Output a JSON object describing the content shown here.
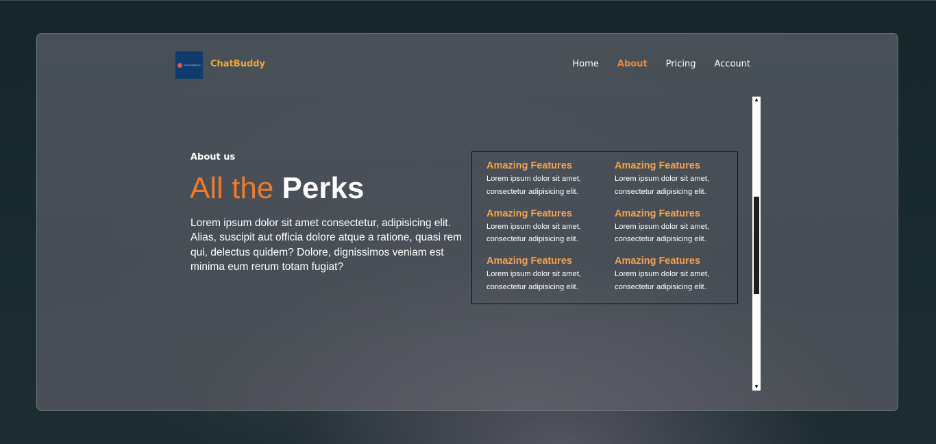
{
  "brand": {
    "name": "ChatBuddy",
    "logo_text": "Chat ChatBuddy",
    "logo_bg_color": "#0f3c6c",
    "brand_color": "#e8a93a"
  },
  "nav": {
    "items": [
      {
        "label": "Home",
        "active": false
      },
      {
        "label": "About",
        "active": true
      },
      {
        "label": "Pricing",
        "active": false
      },
      {
        "label": "Account",
        "active": false
      }
    ],
    "active_color": "#f2873a"
  },
  "hero": {
    "eyebrow": "About us",
    "headline_light": "All the",
    "headline_bold": "Perks",
    "headline_accent_color": "#f07a28",
    "lead": "Lorem ipsum dolor sit amet consectetur, adipisicing elit. Alias, suscipit aut officia dolore atque a ratione, quasi rem qui, delectus quidem? Dolore, dignissimos veniam est minima eum rerum totam fugiat?"
  },
  "features": {
    "title_color": "#f5a24a",
    "items": [
      {
        "title": "Amazing Features",
        "body": "Lorem ipsum dolor sit amet, consectetur adipisicing elit."
      },
      {
        "title": "Amazing Features",
        "body": "Lorem ipsum dolor sit amet, consectetur adipisicing elit."
      },
      {
        "title": "Amazing Features",
        "body": "Lorem ipsum dolor sit amet, consectetur adipisicing elit."
      },
      {
        "title": "Amazing Features",
        "body": "Lorem ipsum dolor sit amet, consectetur adipisicing elit."
      },
      {
        "title": "Amazing Features",
        "body": "Lorem ipsum dolor sit amet, consectetur adipisicing elit."
      },
      {
        "title": "Amazing Features",
        "body": "Lorem ipsum dolor sit amet, consectetur adipisicing elit."
      }
    ]
  },
  "scrollbar": {
    "up_icon": "triangle-up-icon",
    "down_icon": "triangle-down-icon",
    "thumb_position_fraction": 0.34
  }
}
